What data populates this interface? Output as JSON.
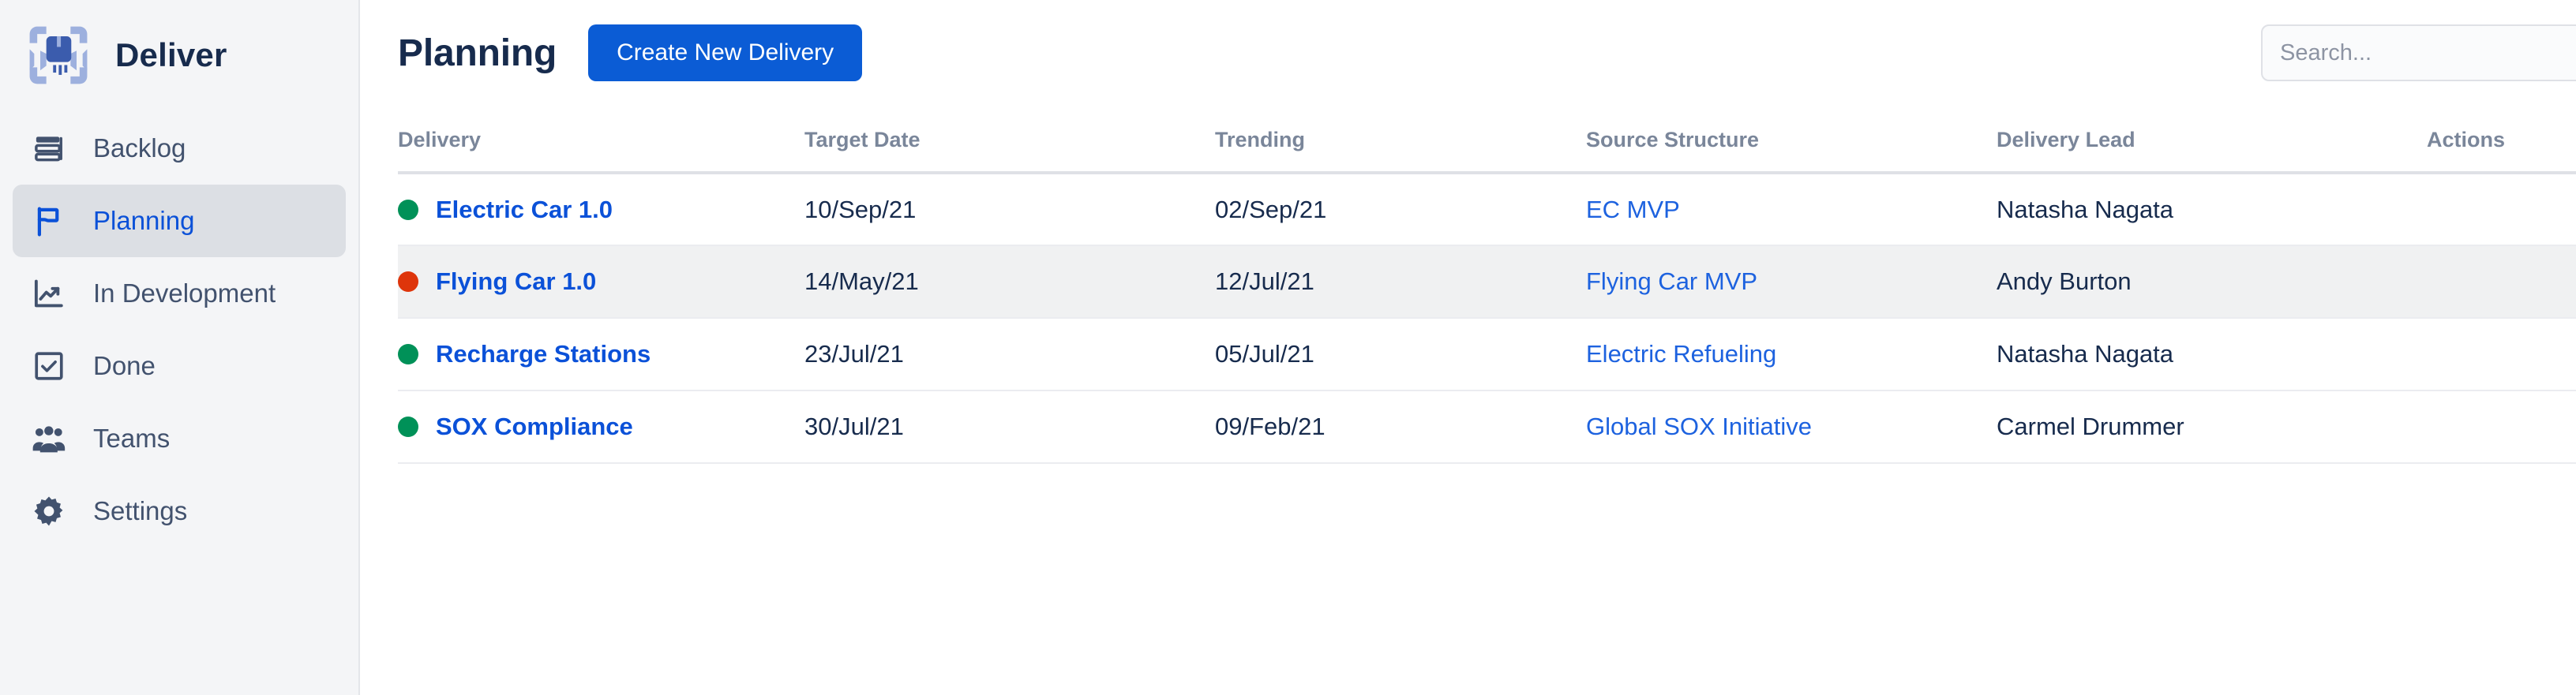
{
  "app": {
    "brand_name": "Deliver",
    "logo_icon": "package-scan-icon"
  },
  "sidebar": {
    "items": [
      {
        "label": "Backlog",
        "icon": "stacked-layers-icon",
        "active": false
      },
      {
        "label": "Planning",
        "icon": "flag-icon",
        "active": true
      },
      {
        "label": "In Development",
        "icon": "trending-up-icon",
        "active": false
      },
      {
        "label": "Done",
        "icon": "checkbox-check-icon",
        "active": false
      },
      {
        "label": "Teams",
        "icon": "people-group-icon",
        "active": false
      },
      {
        "label": "Settings",
        "icon": "gear-icon",
        "active": false
      }
    ]
  },
  "header": {
    "title": "Planning",
    "create_button_label": "Create New Delivery",
    "search_placeholder": "Search...",
    "search_value": ""
  },
  "table": {
    "columns": [
      "Delivery",
      "Target Date",
      "Trending",
      "Source Structure",
      "Delivery Lead",
      "Actions"
    ],
    "rows": [
      {
        "status": "green",
        "delivery": "Electric Car 1.0",
        "target_date": "10/Sep/21",
        "trending": "02/Sep/21",
        "source_structure": "EC MVP",
        "delivery_lead": "Natasha Nagata",
        "actions_icon": "ellipsis-icon"
      },
      {
        "status": "red",
        "delivery": "Flying Car 1.0",
        "target_date": "14/May/21",
        "trending": "12/Jul/21",
        "source_structure": "Flying Car MVP",
        "delivery_lead": "Andy Burton",
        "actions_icon": "ellipsis-icon"
      },
      {
        "status": "green",
        "delivery": "Recharge Stations",
        "target_date": "23/Jul/21",
        "trending": "05/Jul/21",
        "source_structure": "Electric Refueling",
        "delivery_lead": "Natasha Nagata",
        "actions_icon": "ellipsis-icon"
      },
      {
        "status": "green",
        "delivery": "SOX Compliance",
        "target_date": "30/Jul/21",
        "trending": "09/Feb/21",
        "source_structure": "Global SOX Initiative",
        "delivery_lead": "Carmel Drummer",
        "actions_icon": "ellipsis-icon"
      }
    ]
  },
  "colors": {
    "status_green": "#009158",
    "status_red": "#de350b",
    "primary_blue": "#0b5cd5",
    "link_blue": "#0b51d8",
    "sidebar_bg": "#f4f5f7",
    "sidebar_active_bg": "#dcdfe4",
    "row_alt_bg": "#f0f1f2",
    "text_dark": "#172b4d",
    "text_muted": "#7a869a"
  }
}
